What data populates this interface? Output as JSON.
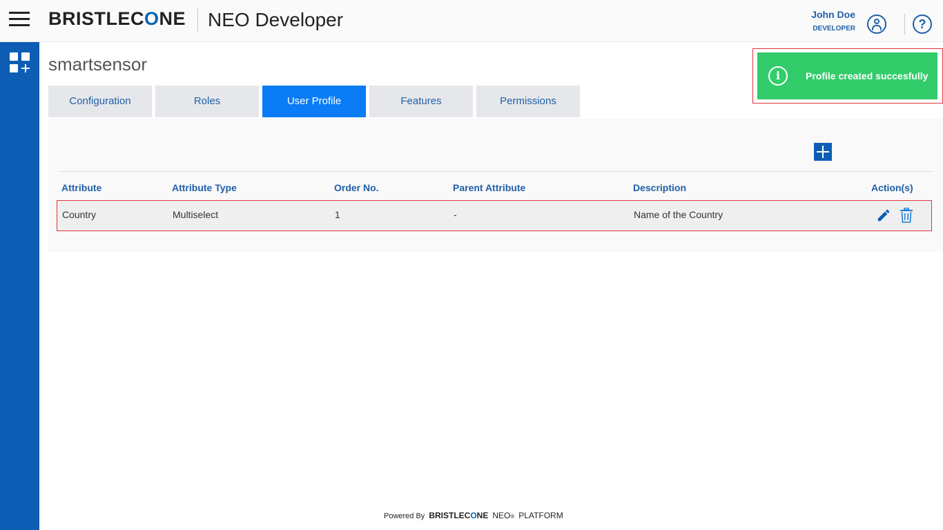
{
  "header": {
    "logo_pre": "BRISTLEC",
    "logo_o": "O",
    "logo_post": "NE",
    "app_title": "NEO Developer",
    "user_name": "John Doe",
    "user_role": "DEVELOPER"
  },
  "page": {
    "title": "smartsensor"
  },
  "tabs": [
    {
      "label": "Configuration",
      "active": false
    },
    {
      "label": "Roles",
      "active": false
    },
    {
      "label": "User Profile",
      "active": true
    },
    {
      "label": "Features",
      "active": false
    },
    {
      "label": "Permissions",
      "active": false
    }
  ],
  "table": {
    "headers": [
      "Attribute",
      "Attribute Type",
      "Order No.",
      "Parent Attribute",
      "Description",
      "Action(s)"
    ],
    "rows": [
      [
        "Country",
        "Multiselect",
        "1",
        "-",
        "Name of the Country"
      ]
    ]
  },
  "toast": {
    "message": "Profile created succesfully",
    "icon": "info-icon",
    "color": "#33cc6a"
  },
  "footer": {
    "powered_by": "Powered By",
    "brand_pre": "BRISTLEC",
    "brand_o": "O",
    "brand_post": "NE",
    "neo": "NEO",
    "reg": "®",
    "platform": "PLATFORM"
  },
  "colors": {
    "accent": "#0d5db5",
    "active_tab": "#0a7cf5",
    "link_text": "#1f5fa8",
    "highlight_border": "#e0343a"
  }
}
